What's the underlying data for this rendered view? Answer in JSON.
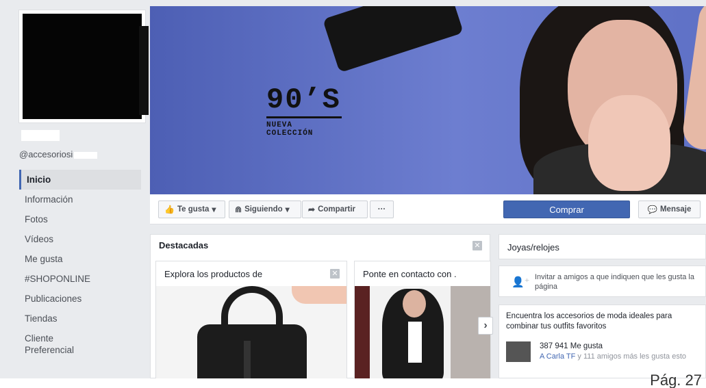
{
  "profile": {
    "handle": "@accesoriosi"
  },
  "nav": [
    {
      "label": "Inicio",
      "active": true
    },
    {
      "label": "Información"
    },
    {
      "label": "Fotos"
    },
    {
      "label": "Vídeos"
    },
    {
      "label": "Me gusta"
    },
    {
      "label": "#SHOPONLINE"
    },
    {
      "label": "Publicaciones"
    },
    {
      "label": "Tiendas"
    },
    {
      "label": "Cliente Preferencial"
    }
  ],
  "cover": {
    "headline": "90’S",
    "sub_line1": "NUEVA",
    "sub_line2": "COLECCIÓN"
  },
  "actions": {
    "like": "Te gusta",
    "following": "Siguiendo",
    "share": "Compartir",
    "more": "···",
    "buy": "Comprar",
    "message": "Mensaje"
  },
  "featured": {
    "title": "Destacadas",
    "close": "✕",
    "cards": [
      {
        "title": "Explora los productos de"
      },
      {
        "title": "Ponte en contacto con ."
      }
    ],
    "next": "›"
  },
  "sidebar": {
    "category": "Joyas/relojes",
    "invite_text": "Invitar a amigos a que indiquen que les gusta la página",
    "about": "Encuentra los accesorios de moda ideales para combinar tus outfits favoritos",
    "likes_count": "387 941 Me gusta",
    "likes_friend": "A Carla TF",
    "likes_rest": " y 111 amigos más les gusta esto"
  },
  "page_number": "Pág. 27",
  "colors": {
    "brand_blue": "#4267b2",
    "cover_blue": "#5f71c6",
    "page_bg": "#e9ebee"
  }
}
